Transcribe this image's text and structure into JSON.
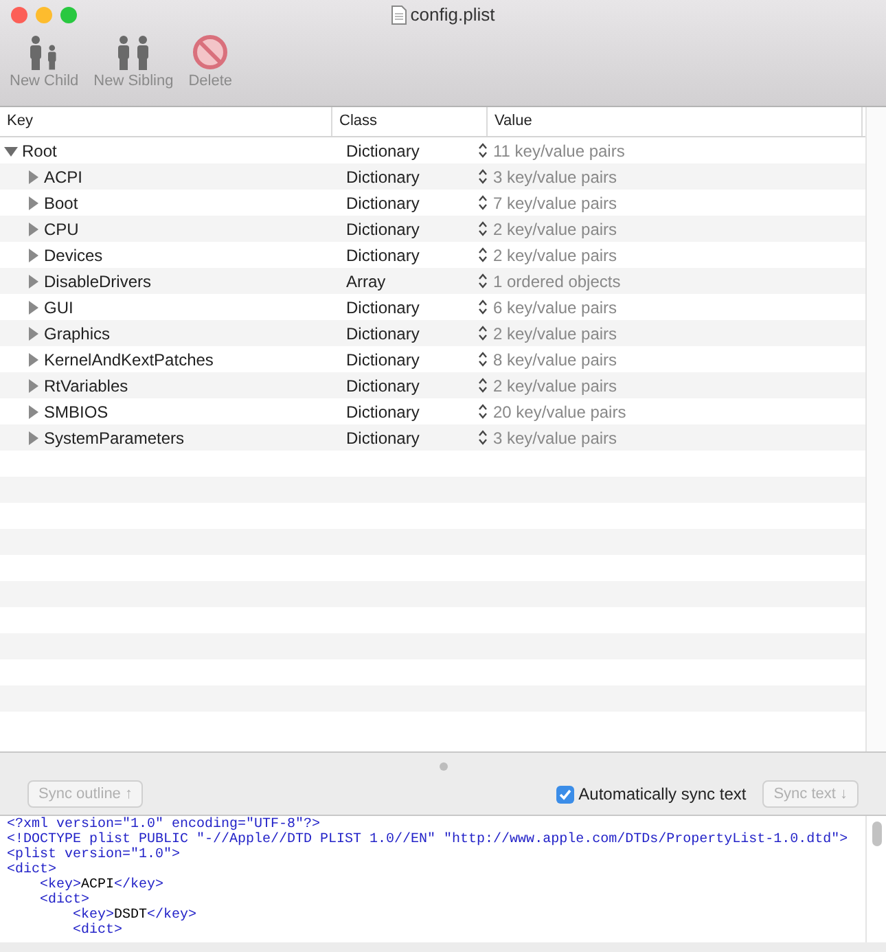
{
  "window": {
    "title": "config.plist"
  },
  "toolbar": [
    {
      "kind": "child",
      "label": "New Child",
      "disabled": true
    },
    {
      "kind": "sibling",
      "label": "New Sibling",
      "disabled": true
    },
    {
      "kind": "delete",
      "label": "Delete",
      "disabled": true
    }
  ],
  "table": {
    "columns": [
      "Key",
      "Class",
      "Value"
    ],
    "rows": [
      {
        "key": "Root",
        "class": "Dictionary",
        "value": "11 key/value pairs",
        "expanded": true,
        "children": [
          {
            "key": "ACPI",
            "class": "Dictionary",
            "value": "3 key/value pairs",
            "expanded": false
          },
          {
            "key": "Boot",
            "class": "Dictionary",
            "value": "7 key/value pairs",
            "expanded": false
          },
          {
            "key": "CPU",
            "class": "Dictionary",
            "value": "2 key/value pairs",
            "expanded": false
          },
          {
            "key": "Devices",
            "class": "Dictionary",
            "value": "2 key/value pairs",
            "expanded": false
          },
          {
            "key": "DisableDrivers",
            "class": "Array",
            "value": "1 ordered objects",
            "expanded": false
          },
          {
            "key": "GUI",
            "class": "Dictionary",
            "value": "6 key/value pairs",
            "expanded": false
          },
          {
            "key": "Graphics",
            "class": "Dictionary",
            "value": "2 key/value pairs",
            "expanded": false
          },
          {
            "key": "KernelAndKextPatches",
            "class": "Dictionary",
            "value": "8 key/value pairs",
            "expanded": false
          },
          {
            "key": "RtVariables",
            "class": "Dictionary",
            "value": "2 key/value pairs",
            "expanded": false
          },
          {
            "key": "SMBIOS",
            "class": "Dictionary",
            "value": "20 key/value pairs",
            "expanded": false
          },
          {
            "key": "SystemParameters",
            "class": "Dictionary",
            "value": "3 key/value pairs",
            "expanded": false
          }
        ]
      }
    ]
  },
  "sync_bar": {
    "sync_outline": {
      "label": "Sync outline ↑",
      "disabled": true
    },
    "auto_sync": {
      "label": "Automatically sync text",
      "checked": true
    },
    "sync_text": {
      "label": "Sync text ↓",
      "disabled": true
    }
  },
  "xml_text": [
    "<?xml version=\"1.0\" encoding=\"UTF-8\"?>",
    "<!DOCTYPE plist PUBLIC \"-//Apple//DTD PLIST 1.0//EN\" \"http://www.apple.com/DTDs/PropertyList-1.0.dtd\">",
    "<plist version=\"1.0\">",
    "<dict>",
    "    <key>ACPI</key>",
    "    <dict>",
    "        <key>DSDT</key>",
    "        <dict>"
  ]
}
